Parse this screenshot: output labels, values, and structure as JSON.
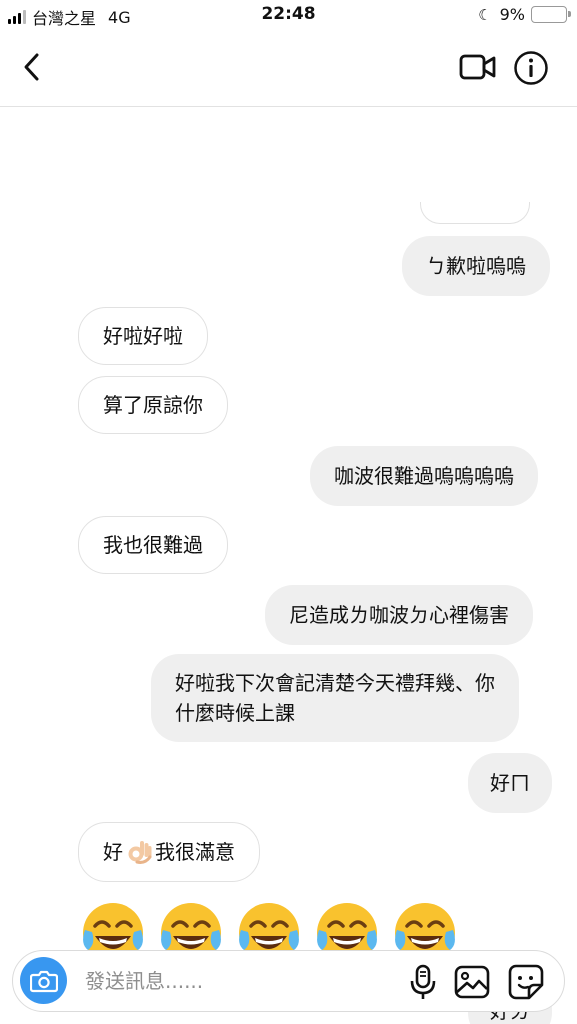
{
  "status_bar": {
    "carrier": "台灣之星",
    "network": "4G",
    "time": "22:48",
    "battery_percent": "9%",
    "battery_level": 0.09,
    "battery_color": "#f2c200",
    "icons": [
      "signal-bars-icon",
      "moon-icon",
      "battery-icon"
    ]
  },
  "header": {
    "icons": [
      "back-chevron-icon",
      "video-camera-icon",
      "info-icon"
    ]
  },
  "messages": [
    {
      "side": "out",
      "text": "ㄅ歉啦嗚嗚"
    },
    {
      "side": "in",
      "text": "好啦好啦"
    },
    {
      "side": "in",
      "text": "算了原諒你"
    },
    {
      "side": "out",
      "text": "咖波很難過嗚嗚嗚嗚"
    },
    {
      "side": "in",
      "text": "我也很難過"
    },
    {
      "side": "out",
      "text": "尼造成ㄌ咖波ㄉ心裡傷害"
    },
    {
      "side": "out",
      "line1": "好啦我下次會記清楚今天禮拜幾、你",
      "line2": "什麼時候上課"
    },
    {
      "side": "out",
      "text": "好ㄇ"
    },
    {
      "side": "in",
      "before": "好",
      "emoji": "ok-hand-emoji",
      "after": "我很滿意"
    },
    {
      "side": "in",
      "emoji_row": [
        "face-with-tears-of-joy-emoji",
        "face-with-tears-of-joy-emoji",
        "face-with-tears-of-joy-emoji",
        "face-with-tears-of-joy-emoji",
        "face-with-tears-of-joy-emoji"
      ]
    },
    {
      "side": "out",
      "text": "好ㄉ"
    }
  ],
  "composer": {
    "placeholder": "發送訊息......",
    "accent_color": "#3897f0",
    "icons": [
      "camera-icon",
      "microphone-icon",
      "gallery-icon",
      "sticker-icon"
    ]
  }
}
